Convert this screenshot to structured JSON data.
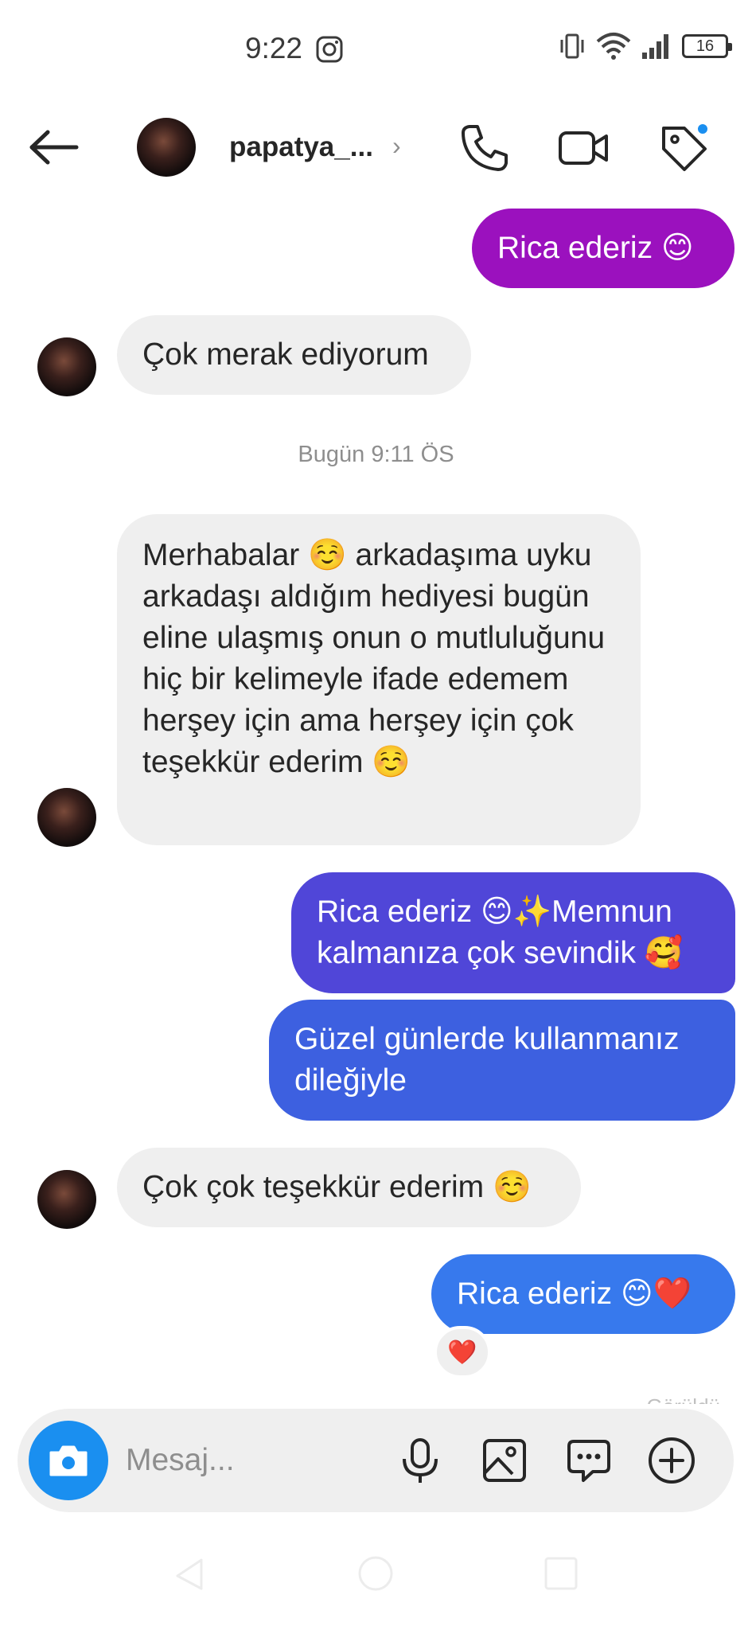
{
  "status_bar": {
    "time": "9:22",
    "battery": "16",
    "icons": [
      "instagram-icon",
      "vibrate-icon",
      "wifi-icon",
      "signal-icon",
      "battery-icon"
    ]
  },
  "header": {
    "username": "papatya_...",
    "chevron": "›",
    "icons": [
      "back-arrow-icon",
      "phone-icon",
      "video-camera-icon",
      "tag-icon"
    ]
  },
  "messages": [
    {
      "direction": "out",
      "text": "Rica ederiz 😊",
      "color": "#9b11be"
    },
    {
      "direction": "in",
      "text": "Çok merak ediyorum"
    },
    {
      "direction": "in",
      "text": "Merhabalar ☺️  arkadaşıma uyku arkadaşı aldığım hediyesi bugün eline ulaşmış onun o mutluluğunu hiç bir kelimeyle ifade edemem herşey için ama herşey için çok teşekkür ederim ☺️"
    },
    {
      "direction": "out",
      "text": "Rica ederiz 😊✨Memnun kalmanıza çok sevindik 🥰",
      "color": "#5046d8"
    },
    {
      "direction": "out",
      "text": "Güzel günlerde kullanmanız dileğiyle",
      "color": "#3d60e0"
    },
    {
      "direction": "in",
      "text": "Çok çok teşekkür ederim ☺️"
    },
    {
      "direction": "out",
      "text": "Rica ederiz 😊❤️",
      "color": "#3779ed"
    }
  ],
  "timestamp": "Bugün 9:11 ÖS",
  "reaction": "❤️",
  "seen_text": "Görüldü",
  "composer": {
    "placeholder": "Mesaj...",
    "icons": [
      "camera-icon",
      "microphone-icon",
      "gallery-icon",
      "sticker-icon",
      "plus-icon"
    ]
  },
  "colors": {
    "accent": "#1a8ff0",
    "incoming_bubble": "#efefef",
    "timestamp": "#8e8e8e"
  }
}
